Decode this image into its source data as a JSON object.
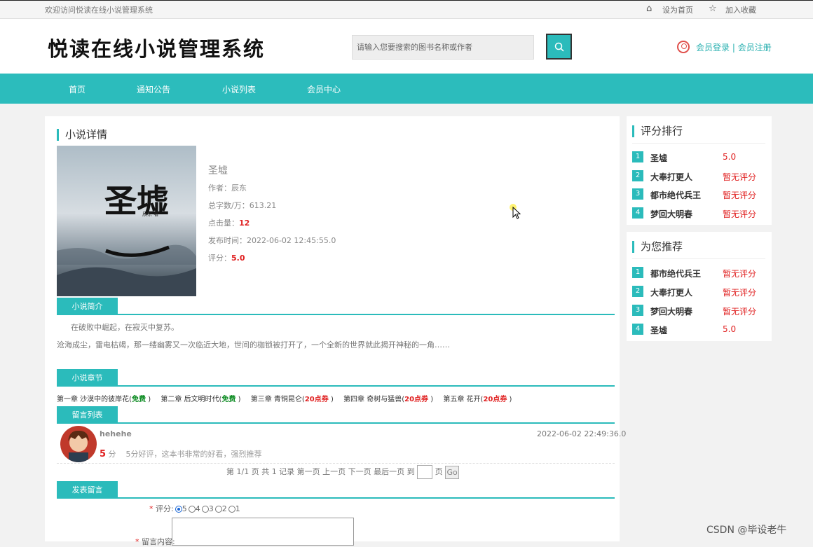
{
  "topbar": {
    "welcome": "欢迎访问悦读在线小说管理系统",
    "set_home": "设为首页",
    "add_fav": "加入收藏"
  },
  "header": {
    "title": "悦读在线小说管理系统",
    "search_placeholder": "请输入您要搜索的图书名称或作者",
    "login": "会员登录",
    "separator": "|",
    "register": "会员注册"
  },
  "nav": [
    "首页",
    "通知公告",
    "小说列表",
    "会员中心"
  ],
  "detail": {
    "section_title": "小说详情",
    "cover_title": "圣墟",
    "cover_author": "辰东·著",
    "name": "圣墟",
    "author_label": "作者：",
    "author": "辰东",
    "words_label": "总字数/万：",
    "words": "613.21",
    "clicks_label": "点击量：",
    "clicks": "12",
    "publish_label": "发布时间：",
    "publish": "2022-06-02 12:45:55.0",
    "score_label": "评分：",
    "score": "5.0"
  },
  "intro": {
    "tab": "小说简介",
    "line1": "在破败中崛起，在寂灭中复苏。",
    "line2": "沧海成尘，雷电枯竭，那一缕幽雾又一次临近大地，世间的枷锁被打开了，一个全新的世界就此揭开神秘的一角……"
  },
  "chapters": {
    "tab": "小说章节",
    "items": [
      {
        "name": "第一章 沙漠中的彼岸花(",
        "tag": "免费",
        "close": " )"
      },
      {
        "name": "第二章 后文明时代(",
        "tag": "免费",
        "close": " )"
      },
      {
        "name": "第三章 青铜昆仑(",
        "tag": "20点券",
        "close": " )"
      },
      {
        "name": "第四章 奇树与猛兽(",
        "tag": "20点券",
        "close": " )"
      },
      {
        "name": "第五章 花开(",
        "tag": "20点券",
        "close": " )"
      }
    ]
  },
  "comments": {
    "tab": "留言列表",
    "user": "hehehe",
    "time": "2022-06-02 22:49:36.0",
    "score": "5",
    "score_unit": "分",
    "text": "5分好评，这本书非常的好看，强烈推荐",
    "pager": "第 1/1 页 共 1 记录 第一页 上一页 下一页 最后一页 到",
    "page_unit": "页",
    "go": "Go"
  },
  "post": {
    "tab": "发表留言",
    "rate_label": "评分:",
    "required": "*",
    "options": [
      "5",
      "4",
      "3",
      "2",
      "1"
    ],
    "content_label": "留言内容:"
  },
  "ranking": {
    "title": "评分排行",
    "items": [
      {
        "num": "1",
        "name": "圣墟",
        "score": "5.0"
      },
      {
        "num": "2",
        "name": "大奉打更人",
        "score": "暂无评分"
      },
      {
        "num": "3",
        "name": "都市绝代兵王",
        "score": "暂无评分"
      },
      {
        "num": "4",
        "name": "梦回大明春",
        "score": "暂无评分"
      }
    ]
  },
  "recommend": {
    "title": "为您推荐",
    "items": [
      {
        "num": "1",
        "name": "都市绝代兵王",
        "score": "暂无评分"
      },
      {
        "num": "2",
        "name": "大奉打更人",
        "score": "暂无评分"
      },
      {
        "num": "3",
        "name": "梦回大明春",
        "score": "暂无评分"
      },
      {
        "num": "4",
        "name": "圣墟",
        "score": "5.0"
      }
    ]
  },
  "watermark": "CSDN @毕设老牛",
  "colors": {
    "accent": "#2bbbbb",
    "score_red": "#e02020",
    "free_green": "#0a8a20"
  }
}
